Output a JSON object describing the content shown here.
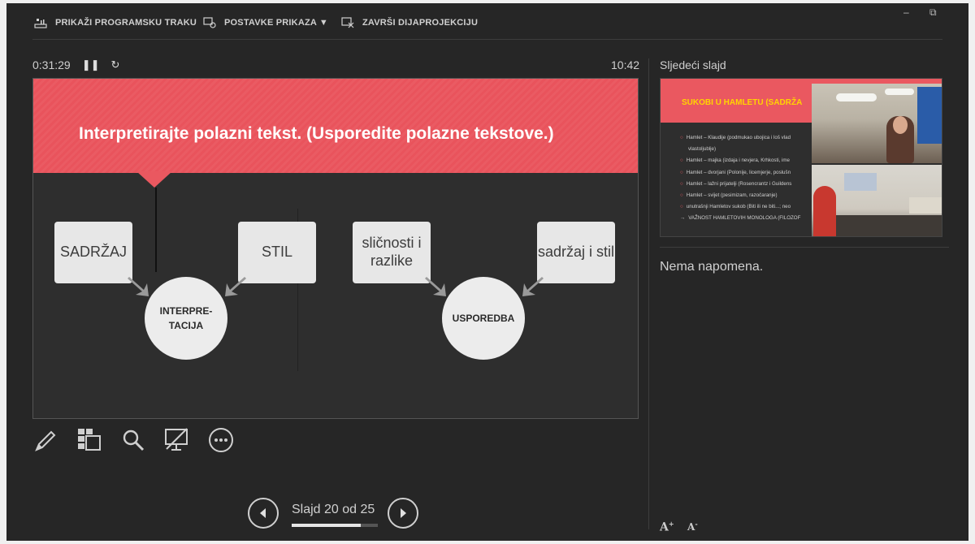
{
  "toolbar": {
    "show_taskbar": "PRIKAŽI PROGRAMSKU TRAKU",
    "display_settings": "POSTAVKE PRIKAZA ▼",
    "end_slideshow": "ZAVRŠI DIJAPROJEKCIJU"
  },
  "window_controls": {
    "minimize": "–",
    "restore": "⧉"
  },
  "timer": {
    "elapsed": "0:31:29",
    "clock": "10:42"
  },
  "slide": {
    "title": "Interpretirajte polazni tekst. (Usporedite polazne tekstove.)",
    "left_group": {
      "box1": "SADRŽAJ",
      "box2": "STIL",
      "circle": "INTERPRE-\nTACIJA"
    },
    "right_group": {
      "box1": "sličnosti i razlike",
      "box2": "sadržaj i stil",
      "circle": "USPOREDBA"
    }
  },
  "tools": [
    "pen-icon",
    "slides-grid-icon",
    "zoom-icon",
    "screen-off-icon",
    "more-options-icon"
  ],
  "navigation": {
    "label": "Slajd 20 od 25",
    "current": 20,
    "total": 25
  },
  "next_slide": {
    "label": "Sljedeći slajd",
    "title": "SUKOBI U HAMLETU (SADRŽA",
    "items": [
      "Hamlet – Klaudije (podmukao ubojica i loš vlad",
      "vlastoljublje)",
      "Hamlet – majka (izdaja i nevjera, Krhkosti, ime",
      "Hamlet – dvorjani (Polonije, licemjerje, poslušn",
      "Hamlet – lažni prijatelji (Rosencrantz i Guildens",
      "Hamlet – svijet (pesimizam, razočaranje)",
      "unutrašnji Hamletov sukob (Biti ili ne biti...; neo",
      "VAŽNOST HAMLETOVIH MONOLOGA (FILOZOF"
    ]
  },
  "notes": {
    "text": "Nema napomena."
  },
  "font_controls": {
    "increase": "A",
    "decrease": "A"
  },
  "colors": {
    "accent": "#ea5860",
    "background": "#262626",
    "thumb_title": "#ffd400"
  }
}
